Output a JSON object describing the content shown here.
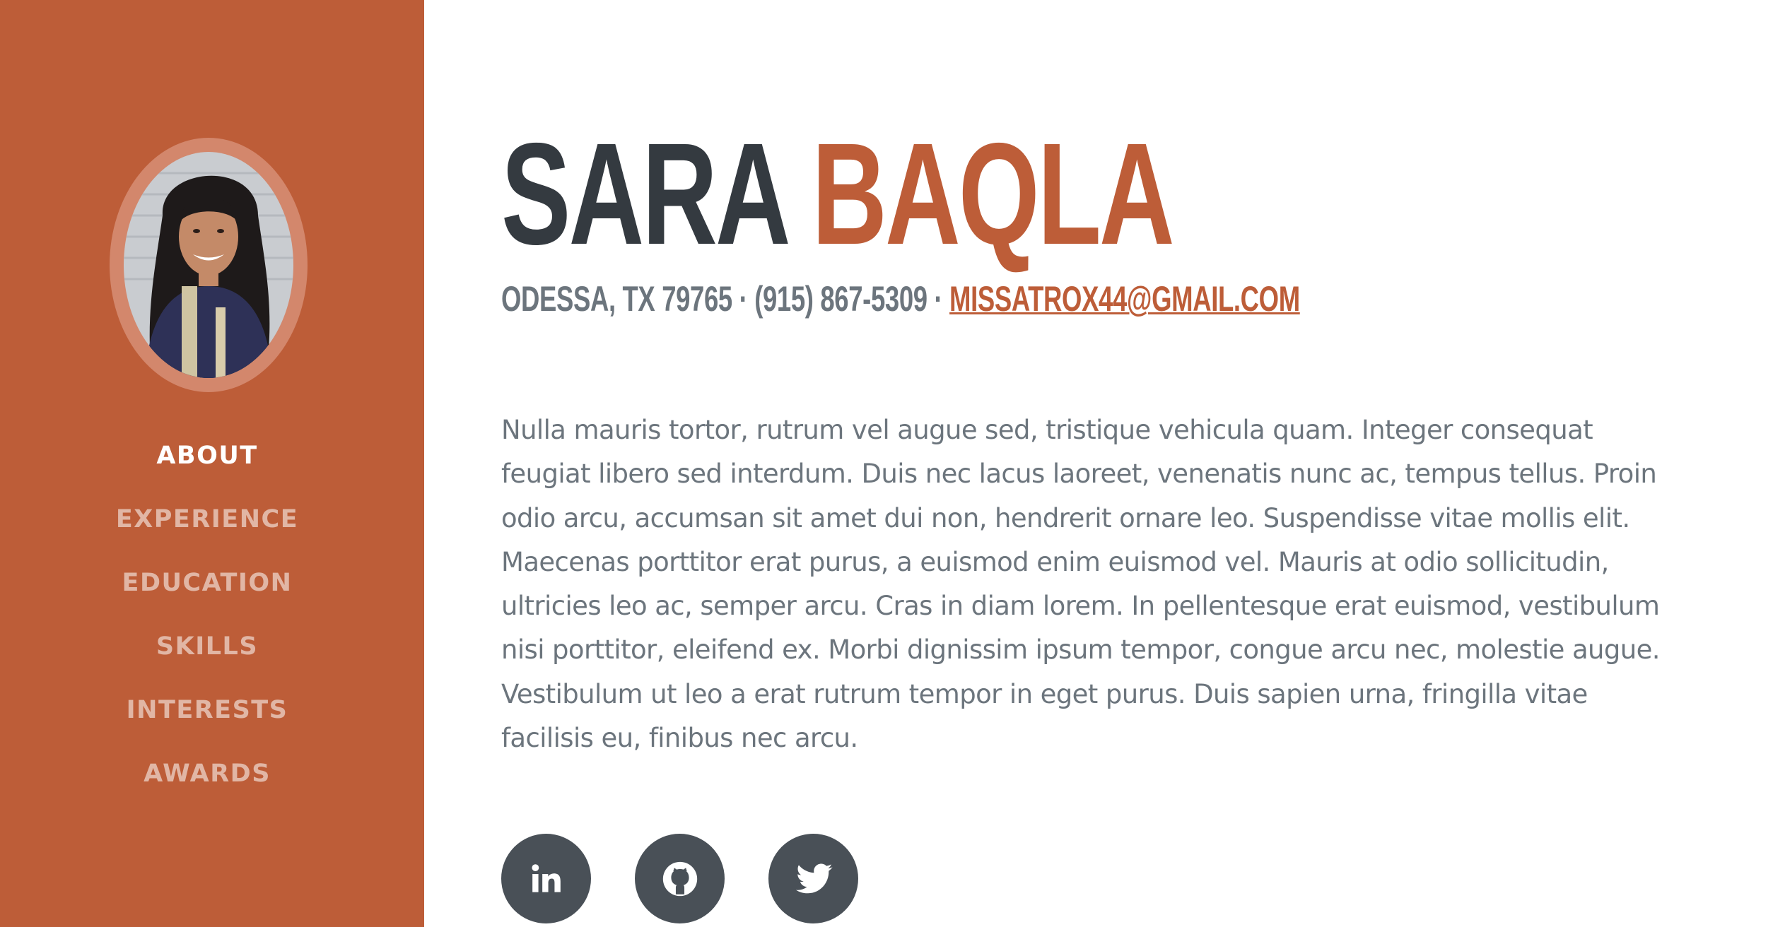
{
  "colors": {
    "primary": "#bd5d38",
    "dark": "#343a40",
    "muted": "#6c757d",
    "social_bg": "#495057"
  },
  "profile": {
    "first_name": "SARA",
    "last_name": "BAQLA"
  },
  "contact": {
    "address": "ODESSA, TX 79765 · (915) 867-5309 · ",
    "email": "MISSATROX44@GMAIL.COM"
  },
  "nav": {
    "items": [
      {
        "label": "ABOUT",
        "active": true
      },
      {
        "label": "EXPERIENCE"
      },
      {
        "label": "EDUCATION"
      },
      {
        "label": "SKILLS"
      },
      {
        "label": "INTERESTS"
      },
      {
        "label": "AWARDS"
      }
    ]
  },
  "about": {
    "text": "Nulla mauris tortor, rutrum vel augue sed, tristique vehicula quam. Integer consequat feugiat libero sed interdum. Duis nec lacus laoreet, venenatis nunc ac, tempus tellus. Proin odio arcu, accumsan sit amet dui non, hendrerit ornare leo. Suspendisse vitae mollis elit. Maecenas porttitor erat purus, a euismod enim euismod vel. Mauris at odio sollicitudin, ultricies leo ac, semper arcu. Cras in diam lorem. In pellentesque erat euismod, vestibulum nisi porttitor, eleifend ex. Morbi dignissim ipsum tempor, congue arcu nec, molestie augue. Vestibulum ut leo a erat rutrum tempor in eget purus. Duis sapien urna, fringilla vitae facilisis eu, finibus nec arcu."
  },
  "social": [
    {
      "icon": "linkedin-icon"
    },
    {
      "icon": "github-icon"
    },
    {
      "icon": "twitter-icon"
    }
  ]
}
